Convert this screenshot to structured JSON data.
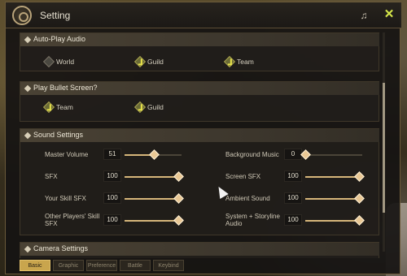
{
  "window": {
    "title": "Setting"
  },
  "auto_play_audio": {
    "title": "Auto-Play Audio",
    "options": [
      {
        "label": "World",
        "checked": false
      },
      {
        "label": "Guild",
        "checked": true
      },
      {
        "label": "Team",
        "checked": true
      }
    ]
  },
  "play_bullet_screen": {
    "title": "Play Bullet Screen?",
    "options": [
      {
        "label": "Team",
        "checked": true
      },
      {
        "label": "Guild",
        "checked": true
      }
    ]
  },
  "sound_settings": {
    "title": "Sound Settings",
    "left": [
      {
        "label": "Master Volume",
        "value": "51",
        "level": 0.51
      },
      {
        "label": "SFX",
        "value": "100",
        "level": 1.0
      },
      {
        "label": "Your Skill SFX",
        "value": "100",
        "level": 1.0
      },
      {
        "label": "Other Players' Skill SFX",
        "value": "100",
        "level": 1.0
      }
    ],
    "right": [
      {
        "label": "Background Music",
        "value": "0",
        "level": 0.0
      },
      {
        "label": "Screen SFX",
        "value": "100",
        "level": 1.0
      },
      {
        "label": "Ambient Sound",
        "value": "100",
        "level": 1.0
      },
      {
        "label": "System + Storyline Audio",
        "value": "100",
        "level": 1.0
      }
    ]
  },
  "camera_settings": {
    "title": "Camera Settings"
  },
  "tabs": [
    "Basic",
    "Graphic",
    "Preference",
    "Battle",
    "Keybind"
  ],
  "active_tab": "Basic",
  "icons": {
    "logo": "gear-emblem-icon",
    "headset": "headset-icon",
    "close": "close-icon",
    "section": "diamond-bullet-icon",
    "checkbox": "diamond-check-icon",
    "slider_knob": "diamond-knob-icon"
  },
  "colors": {
    "accent": "#d6b67a",
    "check": "#e7e24a",
    "close": "#d7e84a",
    "active_tab": "#c9a54d"
  }
}
